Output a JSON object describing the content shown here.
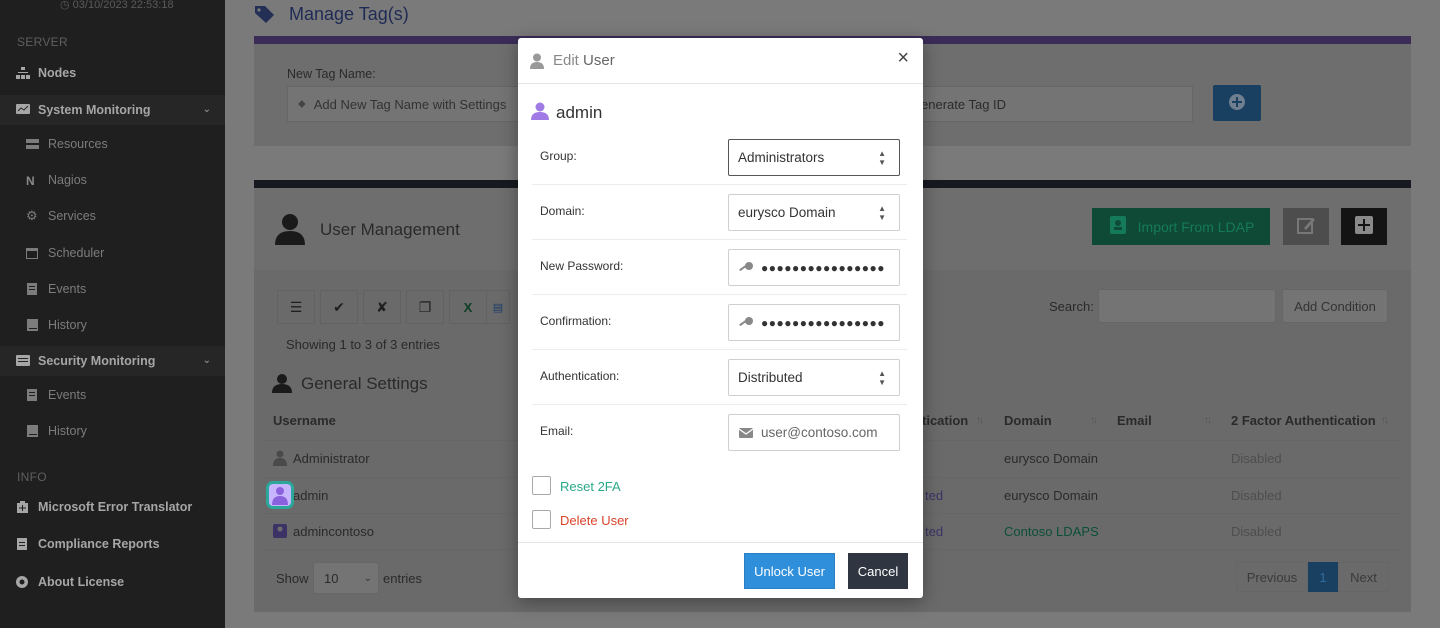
{
  "sidebar": {
    "timestamp": "03/10/2023 22:53:18",
    "section_server": "SERVER",
    "nodes": "Nodes",
    "system_monitoring": "System Monitoring",
    "resources": "Resources",
    "nagios": "Nagios",
    "services": "Services",
    "scheduler": "Scheduler",
    "events": "Events",
    "history": "History",
    "security_monitoring": "Security Monitoring",
    "sec_events": "Events",
    "sec_history": "History",
    "section_info": "INFO",
    "error_translator": "Microsoft Error Translator",
    "compliance": "Compliance Reports",
    "license": "About License"
  },
  "tags": {
    "title": "Manage Tag(s)",
    "new_tag_label": "New Tag Name:",
    "new_tag_placeholder": "Add New Tag Name with Settings",
    "generate_placeholder": "enerate Tag ID"
  },
  "users": {
    "title": "User Management",
    "import_ldap": "Import From LDAP",
    "showing": "Showing 1 to 3 of 3 entries",
    "search_label": "Search:",
    "add_condition": "Add Condition",
    "general_settings": "General Settings",
    "columns": {
      "username": "Username",
      "authentication": "tication",
      "domain": "Domain",
      "email": "Email",
      "twofa": "2 Factor Authentication"
    },
    "rows": [
      {
        "username": "Administrator",
        "auth": "",
        "domain": "eurysco Domain",
        "twofa": "Disabled"
      },
      {
        "username": "admin",
        "auth": "ted",
        "domain": "eurysco Domain",
        "twofa": "Disabled"
      },
      {
        "username": "admincontoso",
        "auth": "ted",
        "domain": "Contoso LDAPS",
        "twofa": "Disabled"
      }
    ],
    "show_label": "Show",
    "page_size": "10",
    "entries_label": "entries",
    "prev": "Previous",
    "page": "1",
    "next": "Next"
  },
  "modal": {
    "title_prefix": "Edit",
    "title_suffix": "User",
    "username": "admin",
    "group_label": "Group:",
    "group_value": "Administrators",
    "domain_label": "Domain:",
    "domain_value": "eurysco Domain",
    "password_label": "New Password:",
    "password_value": "●●●●●●●●●●●●●●●●",
    "confirm_label": "Confirmation:",
    "confirm_value": "●●●●●●●●●●●●●●●●",
    "auth_label": "Authentication:",
    "auth_value": "Distributed",
    "email_label": "Email:",
    "email_placeholder": "user@contoso.com",
    "reset_2fa": "Reset 2FA",
    "delete_user": "Delete User",
    "unlock_prefix": "Unlock",
    "unlock_suffix": "User",
    "cancel": "Cancel"
  },
  "colors": {
    "accent_blue": "#2f8fdb",
    "reset_green": "#2aa889",
    "delete_red": "#d9452b",
    "user_purple": "#a07be6"
  }
}
